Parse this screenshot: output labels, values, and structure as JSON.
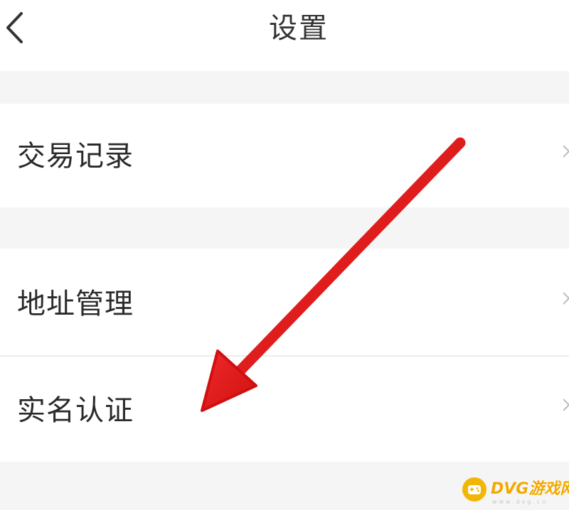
{
  "header": {
    "title": "设置",
    "back_icon": "chevron-left-icon"
  },
  "settings": {
    "items": [
      {
        "label": "交易记录",
        "icon": "chevron-right-icon"
      },
      {
        "label": "地址管理",
        "icon": "chevron-right-icon"
      },
      {
        "label": "实名认证",
        "icon": "chevron-right-icon"
      }
    ]
  },
  "annotation": {
    "arrow_color": "#e01b1b",
    "arrow_icon": "red-arrow-annotation"
  },
  "watermark": {
    "text": "DVG游戏网",
    "sub": "www.dvg.cn",
    "color": "#f2a900"
  }
}
